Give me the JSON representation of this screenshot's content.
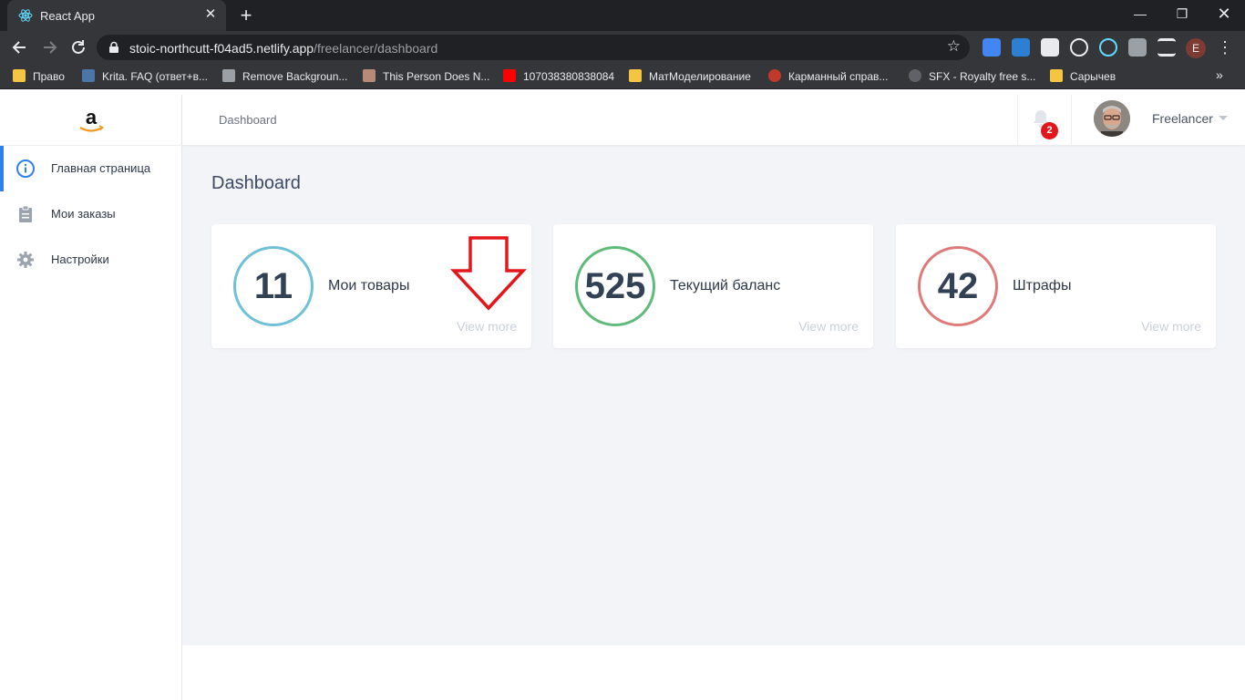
{
  "browser": {
    "tab_title": "React App",
    "url_host": "stoic-northcutt-f04ad5.netlify.app",
    "url_path": "/freelancer/dashboard",
    "profile_initial": "E",
    "bookmarks": [
      {
        "label": "Право",
        "icon": "folder-icon",
        "color": "#f4c542"
      },
      {
        "label": "Krita. FAQ (ответ+в...",
        "icon": "vk-icon",
        "color": "#4a76a8"
      },
      {
        "label": "Remove Backgroun...",
        "icon": "layers-icon",
        "color": "#9aa0a6"
      },
      {
        "label": "This Person Does N...",
        "icon": "face-icon",
        "color": "#b58a78"
      },
      {
        "label": "107038380838084",
        "icon": "youtube-icon",
        "color": "#ff0000"
      },
      {
        "label": "МатМоделирование",
        "icon": "folder-icon",
        "color": "#f4c542"
      },
      {
        "label": "Карманный справ...",
        "icon": "pg-icon",
        "color": "#c0392b"
      },
      {
        "label": "SFX - Royalty free s...",
        "icon": "sfx-icon",
        "color": "#5f6368"
      },
      {
        "label": "Сарычев",
        "icon": "folder-icon",
        "color": "#f4c542"
      }
    ],
    "more_bookmarks": "»"
  },
  "sidebar": {
    "items": [
      {
        "label": "Главная страница",
        "icon": "info-icon",
        "active": true
      },
      {
        "label": "Мои заказы",
        "icon": "clipboard-icon",
        "active": false
      },
      {
        "label": "Настройки",
        "icon": "gear-icon",
        "active": false
      }
    ]
  },
  "topbar": {
    "breadcrumb": "Dashboard",
    "notifications_count": "2",
    "user_name": "Freelancer"
  },
  "main": {
    "title": "Dashboard",
    "cards": [
      {
        "value": "11",
        "label": "Мои товары",
        "link": "View more",
        "ring_color": "#6ec1d6"
      },
      {
        "value": "525",
        "label": "Текущий баланс",
        "link": "View more",
        "ring_color": "#5fbb7a"
      },
      {
        "value": "42",
        "label": "Штрафы",
        "link": "View more",
        "ring_color": "#e07a7a"
      }
    ]
  },
  "colors": {
    "accent": "#2f80ed",
    "annotation_arrow": "#e3161c",
    "badge": "#e3161c"
  }
}
